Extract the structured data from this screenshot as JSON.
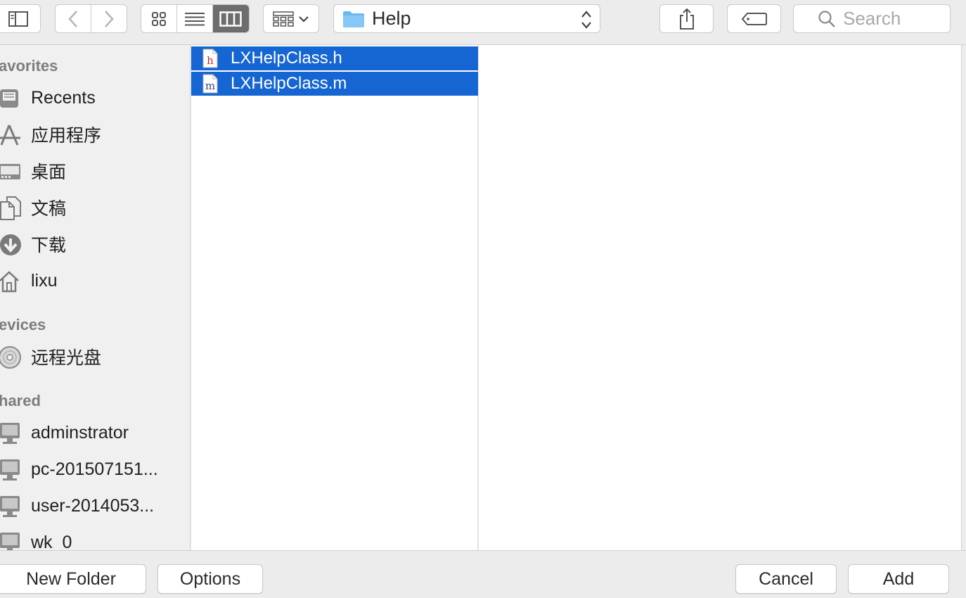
{
  "toolbar": {
    "path_folder": "Help",
    "search_placeholder": "Search"
  },
  "sidebar": {
    "favorites_header": "avorites",
    "favorites": [
      {
        "label": "Recents",
        "icon": "recents-icon"
      },
      {
        "label": "应用程序",
        "icon": "applications-icon"
      },
      {
        "label": "桌面",
        "icon": "desktop-icon"
      },
      {
        "label": "文稿",
        "icon": "documents-icon"
      },
      {
        "label": "下载",
        "icon": "downloads-icon"
      },
      {
        "label": "lixu",
        "icon": "home-icon"
      }
    ],
    "devices_header": "evices",
    "devices": [
      {
        "label": "远程光盘",
        "icon": "disc-icon"
      }
    ],
    "shared_header": "hared",
    "shared": [
      {
        "label": "adminstrator",
        "icon": "computer-icon"
      },
      {
        "label": "pc-201507151...",
        "icon": "computer-icon"
      },
      {
        "label": "user-2014053...",
        "icon": "computer-icon"
      },
      {
        "label": "wk_0",
        "icon": "computer-icon"
      }
    ]
  },
  "browser": {
    "files": [
      {
        "name": "LXHelpClass.h",
        "type_letter": "h",
        "letter_color": "#b0303a",
        "selected": true
      },
      {
        "name": "LXHelpClass.m",
        "type_letter": "m",
        "letter_color": "#3a3f8a",
        "selected": true
      }
    ]
  },
  "bottom": {
    "new_folder": "New Folder",
    "options": "Options",
    "cancel": "Cancel",
    "add": "Add"
  },
  "colors": {
    "selection": "#1565d3",
    "folder": "#6cb9f0"
  }
}
